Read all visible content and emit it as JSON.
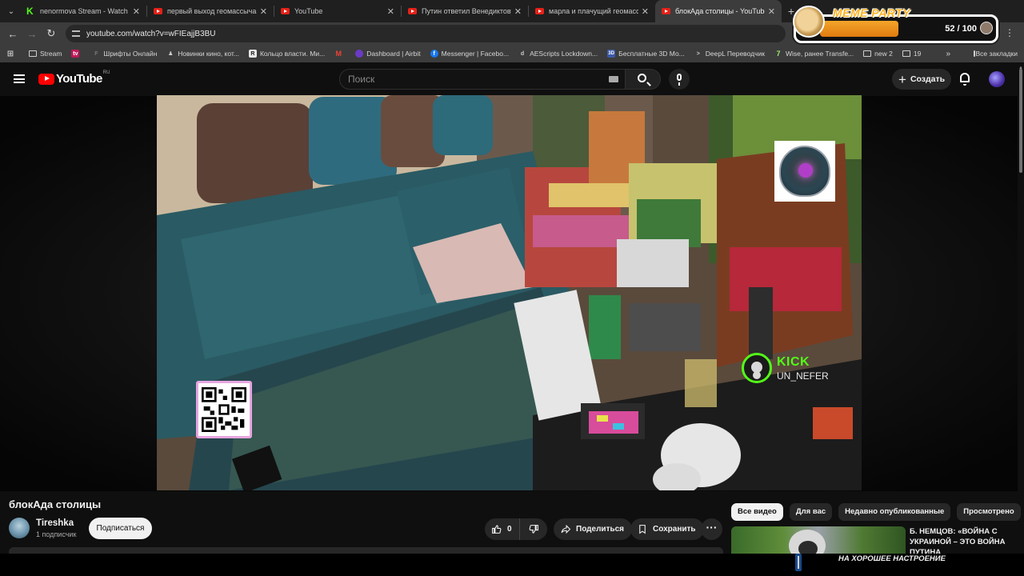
{
  "browser": {
    "tabs": [
      {
        "title": "nenormova Stream - Watch Live",
        "icon": "kick-icon",
        "active": false
      },
      {
        "title": "первый выход геомассыча - YouTube",
        "icon": "youtube-icon",
        "active": false
      },
      {
        "title": "YouTube",
        "icon": "youtube-icon",
        "active": false
      },
      {
        "title": "Путин ответил Венедиктову - YouTube",
        "icon": "youtube-icon",
        "active": false
      },
      {
        "title": "марла и плачущий геомассыч - YouTube",
        "icon": "youtube-icon",
        "active": false
      },
      {
        "title": "блокАда столицы - YouTube",
        "icon": "youtube-icon",
        "active": true
      }
    ],
    "url": "youtube.com/watch?v=wFIEajjB3BU",
    "bookmarks": [
      {
        "label": "Stream",
        "icon": "folder-icon"
      },
      {
        "label": "",
        "icon": "tv-icon"
      },
      {
        "label": "Шрифты Онлайн",
        "icon": "font-icon"
      },
      {
        "label": "Новинки кино, кот...",
        "icon": "film-icon"
      },
      {
        "label": "Кольцо власти. Ми...",
        "icon": "r-icon"
      },
      {
        "label": "",
        "icon": "gmail-icon"
      },
      {
        "label": "Dashboard | Airbit",
        "icon": "airbit-icon"
      },
      {
        "label": "Messenger | Facebo...",
        "icon": "facebook-icon"
      },
      {
        "label": "AEScripts Lockdown...",
        "icon": "aescripts-icon"
      },
      {
        "label": "Бесплатные 3D Мо...",
        "icon": "3d-icon"
      },
      {
        "label": "DeepL Переводчик",
        "icon": "deepl-icon"
      },
      {
        "label": "Wise, ранее Transfe...",
        "icon": "wise-icon"
      },
      {
        "label": "new 2",
        "icon": "folder-icon"
      },
      {
        "label": "19",
        "icon": "folder-icon"
      }
    ],
    "all_bookmarks": "Все закладки"
  },
  "meme_party": {
    "title": "MEME PARTY",
    "count": "52 / 100",
    "progress": 0.52
  },
  "youtube": {
    "region": "RU",
    "logo_text": "YouTube",
    "search_placeholder": "Поиск",
    "create_label": "Создать"
  },
  "video": {
    "title": "блокАда столицы",
    "channel": "Tireshka",
    "subscribers": "1 подписчик",
    "subscribe_label": "Подписаться",
    "likes": "0",
    "share_label": "Поделиться",
    "save_label": "Сохранить",
    "overlay_kick_logo": "KICK",
    "overlay_kick_user": "UN_NEFER"
  },
  "rail": {
    "chips": [
      "Все видео",
      "Для вас",
      "Недавно опубликованные",
      "Просмотрено"
    ],
    "rec_title": "Б. НЕМЦОВ: «ВОЙНА С УКРАИНОЙ – ЭТО ВОЙНА ПУТИНА"
  },
  "ticker": {
    "text": "НА ХОРОШЕЕ НАСТРОЕНИЕ"
  },
  "colors": {
    "bg": "#0f0f0f",
    "youtube_red": "#ff0000",
    "kick_green": "#53fc18",
    "meme_orange": "#f4a52a"
  }
}
